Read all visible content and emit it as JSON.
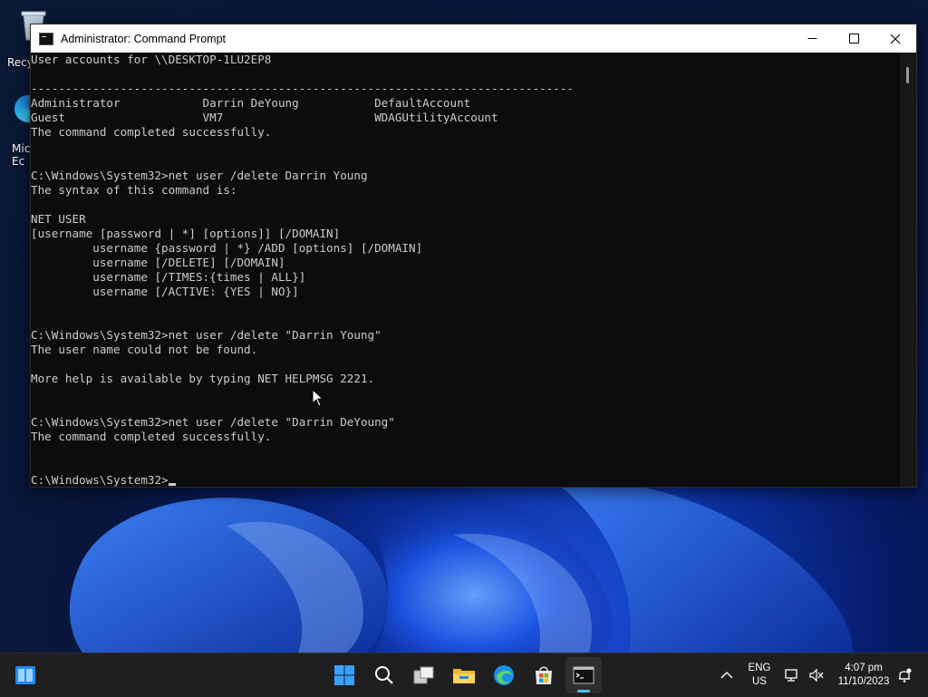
{
  "desktop": {
    "icons": [
      {
        "label": "Recy"
      },
      {
        "label": "Mic\nEc"
      }
    ]
  },
  "window": {
    "title": "Administrator: Command Prompt",
    "buttons": {
      "minimize": "—",
      "maximize": "☐",
      "close": "✕"
    }
  },
  "console": {
    "lines": [
      "User accounts for \\\\DESKTOP-1LU2EP8",
      "",
      "-------------------------------------------------------------------------------",
      "Administrator            Darrin DeYoung           DefaultAccount",
      "Guest                    VM7                      WDAGUtilityAccount",
      "The command completed successfully.",
      "",
      "",
      "C:\\Windows\\System32>net user /delete Darrin Young",
      "The syntax of this command is:",
      "",
      "NET USER",
      "[username [password | *] [options]] [/DOMAIN]",
      "         username {password | *} /ADD [options] [/DOMAIN]",
      "         username [/DELETE] [/DOMAIN]",
      "         username [/TIMES:{times | ALL}]",
      "         username [/ACTIVE: {YES | NO}]",
      "",
      "",
      "C:\\Windows\\System32>net user /delete \"Darrin Young\"",
      "The user name could not be found.",
      "",
      "More help is available by typing NET HELPMSG 2221.",
      "",
      "",
      "C:\\Windows\\System32>net user /delete \"Darrin DeYoung\"",
      "The command completed successfully.",
      "",
      ""
    ],
    "prompt": "C:\\Windows\\System32>"
  },
  "taskbar": {
    "items": [
      {
        "name": "widgets-icon"
      },
      {
        "name": "start-icon"
      },
      {
        "name": "search-icon"
      },
      {
        "name": "task-view-icon"
      },
      {
        "name": "file-explorer-icon"
      },
      {
        "name": "edge-icon"
      },
      {
        "name": "store-icon"
      },
      {
        "name": "terminal-icon",
        "active": true
      }
    ],
    "tray": {
      "lang_top": "ENG",
      "lang_bottom": "US",
      "time": "4:07 pm",
      "date": "11/10/2023"
    }
  },
  "colors": {
    "console_bg": "#0c0c0c",
    "console_fg": "#cccccc",
    "taskbar_bg": "#1f1f1f",
    "accent": "#4cc2ff"
  }
}
